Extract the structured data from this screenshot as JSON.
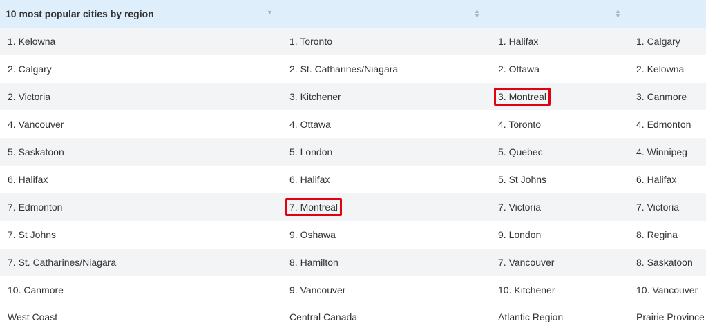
{
  "table": {
    "headers": [
      "10 most popular cities by region",
      "",
      "",
      ""
    ],
    "sort_icons": [
      "chevron-down-icon",
      "sort-icon",
      "sort-icon",
      "sort-icon"
    ],
    "rows": [
      [
        "1. Kelowna",
        "1. Toronto",
        "1. Halifax",
        "1. Calgary"
      ],
      [
        "2. Calgary",
        "2. St. Catharines/Niagara",
        "2. Ottawa",
        "2. Kelowna"
      ],
      [
        "2. Victoria",
        "3. Kitchener",
        "3. Montreal",
        "3. Canmore"
      ],
      [
        "4. Vancouver",
        "4. Ottawa",
        "4. Toronto",
        "4. Edmonton"
      ],
      [
        "5. Saskatoon",
        "5. London",
        "5. Quebec",
        "4. Winnipeg"
      ],
      [
        "6. Halifax",
        "6. Halifax",
        "5. St Johns",
        "6. Halifax"
      ],
      [
        "7. Edmonton",
        "7. Montreal",
        "7. Victoria",
        "7. Victoria"
      ],
      [
        "7. St Johns",
        "9. Oshawa",
        "9. London",
        "8. Regina"
      ],
      [
        "7. St. Catharines/Niagara",
        "8. Hamilton",
        "7. Vancouver",
        "8. Saskatoon"
      ],
      [
        "10. Canmore",
        "9. Vancouver",
        "10. Kitchener",
        "10. Vancouver"
      ]
    ],
    "footer": [
      "West Coast",
      "Central Canada",
      "Atlantic Region",
      "Prairie Province"
    ],
    "highlighted_cells": [
      [
        2,
        2
      ],
      [
        6,
        1
      ]
    ],
    "highlight_color": "#e3000f"
  }
}
